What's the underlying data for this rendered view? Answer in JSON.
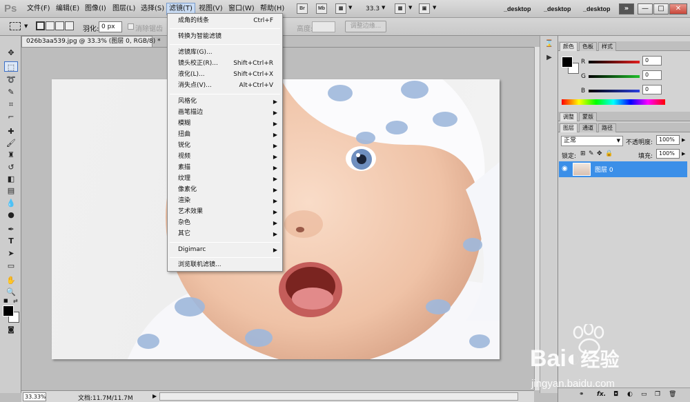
{
  "app": {
    "logo": "Ps"
  },
  "menubar": {
    "items": [
      "文件(F)",
      "编辑(E)",
      "图像(I)",
      "图层(L)",
      "选择(S)",
      "滤镜(T)",
      "视图(V)",
      "窗口(W)",
      "帮助(H)"
    ],
    "bridge_icon": "Br",
    "minibridge_icon": "Mb",
    "zoom_value": "33.3",
    "workspaces": [
      "_desktop",
      "_desktop",
      "_desktop"
    ],
    "more": "»",
    "window_buttons": [
      "—",
      "□",
      "✕"
    ]
  },
  "options": {
    "feather_label": "羽化:",
    "feather_value": "0 px",
    "antialias_label": "消除锯齿",
    "height_label": "高度:",
    "refine_edge": "调整边缘..."
  },
  "document": {
    "tab_title": "026b3aa539.jpg @ 33.3% (图层 0, RGB/8) *",
    "close_icon": "×",
    "zoom": "33.33%",
    "info": "文档:11.7M/11.7M"
  },
  "filter_menu": {
    "groups": [
      [
        {
          "label": "成角的线条",
          "shortcut": "Ctrl+F"
        }
      ],
      [
        {
          "label": "转换为智能滤镜"
        }
      ],
      [
        {
          "label": "滤镜库(G)..."
        },
        {
          "label": "镜头校正(R)...",
          "shortcut": "Shift+Ctrl+R"
        },
        {
          "label": "液化(L)...",
          "shortcut": "Shift+Ctrl+X"
        },
        {
          "label": "消失点(V)...",
          "shortcut": "Alt+Ctrl+V"
        }
      ],
      [
        {
          "label": "风格化",
          "submenu": true
        },
        {
          "label": "画笔描边",
          "submenu": true
        },
        {
          "label": "模糊",
          "submenu": true
        },
        {
          "label": "扭曲",
          "submenu": true
        },
        {
          "label": "锐化",
          "submenu": true
        },
        {
          "label": "视频",
          "submenu": true
        },
        {
          "label": "素描",
          "submenu": true
        },
        {
          "label": "纹理",
          "submenu": true
        },
        {
          "label": "像素化",
          "submenu": true
        },
        {
          "label": "渲染",
          "submenu": true
        },
        {
          "label": "艺术效果",
          "submenu": true
        },
        {
          "label": "杂色",
          "submenu": true
        },
        {
          "label": "其它",
          "submenu": true
        }
      ],
      [
        {
          "label": "Digimarc",
          "submenu": true
        }
      ],
      [
        {
          "label": "浏览联机滤镜..."
        }
      ]
    ]
  },
  "color_panel": {
    "tabs": [
      "颜色",
      "色板",
      "样式"
    ],
    "channels": [
      {
        "label": "R",
        "value": "0",
        "color": "#d92a2a"
      },
      {
        "label": "G",
        "value": "0",
        "color": "#1fa32a"
      },
      {
        "label": "B",
        "value": "0",
        "color": "#2a3fd9"
      }
    ]
  },
  "adjust_panel": {
    "tabs": [
      "调整",
      "蒙版"
    ]
  },
  "layers_panel": {
    "tabs": [
      "图层",
      "通道",
      "路径"
    ],
    "blend_mode": "正常",
    "opacity_label": "不透明度:",
    "opacity": "100%",
    "lock_label": "锁定:",
    "fill_label": "填充:",
    "fill": "100%",
    "layers": [
      {
        "name": "图层 0",
        "selected": true
      }
    ],
    "footer_icons": [
      "link-icon",
      "fx-icon",
      "mask-icon",
      "adjustment-icon",
      "group-icon",
      "new-layer-icon",
      "trash-icon"
    ]
  },
  "watermark": {
    "brand": "Bai",
    "brand2": "经验",
    "domain": "jingyan.baidu.com"
  }
}
